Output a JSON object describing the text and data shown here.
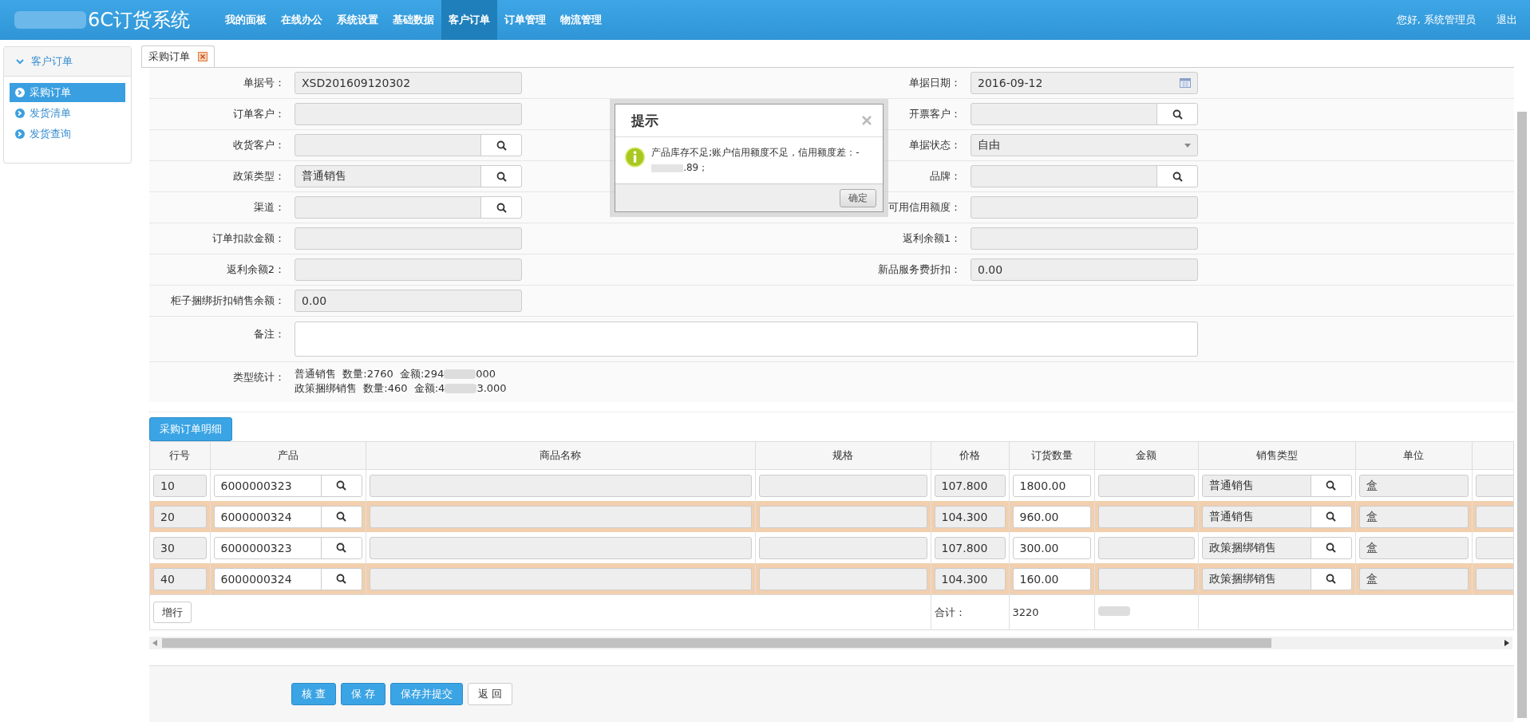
{
  "header": {
    "title": "6C订货系统",
    "nav": [
      {
        "label": "我的面板",
        "selected": false
      },
      {
        "label": "在线办公",
        "selected": false
      },
      {
        "label": "系统设置",
        "selected": false
      },
      {
        "label": "基础数据",
        "selected": false
      },
      {
        "label": "客户订单",
        "selected": true
      },
      {
        "label": "订单管理",
        "selected": false
      },
      {
        "label": "物流管理",
        "selected": false
      }
    ],
    "user": "您好, 系统管理员",
    "logout": "退出"
  },
  "sidebar": {
    "title": "客户订单",
    "items": [
      {
        "label": "采购订单",
        "selected": true
      },
      {
        "label": "发货清单",
        "selected": false
      },
      {
        "label": "发货查询",
        "selected": false
      }
    ]
  },
  "tabs": [
    {
      "label": "采购订单",
      "selected": true
    }
  ],
  "form": {
    "rows": [
      {
        "left": {
          "label": "单据号：",
          "kind": "text",
          "value": "XSD201609120302"
        },
        "right": {
          "label": "单据日期：",
          "kind": "date",
          "value": "2016-09-12"
        }
      },
      {
        "left": {
          "label": "订单客户：",
          "kind": "text"
        },
        "right": {
          "label": "开票客户：",
          "kind": "lookup"
        }
      },
      {
        "left": {
          "label": "收货客户：",
          "kind": "lookup"
        },
        "right": {
          "label": "单据状态：",
          "kind": "select",
          "value": "自由"
        }
      },
      {
        "left": {
          "label": "政策类型：",
          "kind": "lookup",
          "value": "普通销售"
        },
        "right": {
          "label": "品牌：",
          "kind": "lookup"
        }
      },
      {
        "left": {
          "label": "渠道：",
          "kind": "lookup"
        },
        "right": {
          "label": "可用信用额度：",
          "kind": "text"
        }
      },
      {
        "left": {
          "label": "订单扣款金额：",
          "kind": "text"
        },
        "right": {
          "label": "返利余额1：",
          "kind": "text"
        }
      },
      {
        "left": {
          "label": "返利余额2：",
          "kind": "text"
        },
        "right": {
          "label": "新品服务费折扣：",
          "kind": "text",
          "value": "0.00"
        }
      },
      {
        "left": {
          "label": "柜子捆绑折扣销售余额：",
          "kind": "text",
          "value": "0.00"
        }
      }
    ],
    "remark_label": "备注：",
    "stats_label": "类型统计：",
    "stats": [
      {
        "prefix": "普通销售  数量:2760  金额:294",
        "suffix": "000"
      },
      {
        "prefix": "政策捆绑销售  数量:460  金额:4",
        "suffix": "3.000"
      }
    ]
  },
  "detail": {
    "button": "采购订单明细",
    "columns": [
      "行号",
      "产品",
      "商品名称",
      "规格",
      "价格",
      "订货数量",
      "金额",
      "销售类型",
      "单位"
    ],
    "rows": [
      {
        "line": "10",
        "product": "6000000323",
        "price": "107.800",
        "qty": "1800.00",
        "sale_type": "普通销售",
        "unit": "盒",
        "highlighted": false
      },
      {
        "line": "20",
        "product": "6000000324",
        "price": "104.300",
        "qty": "960.00",
        "sale_type": "普通销售",
        "unit": "盒",
        "highlighted": true
      },
      {
        "line": "30",
        "product": "6000000323",
        "price": "107.800",
        "qty": "300.00",
        "sale_type": "政策捆绑销售",
        "unit": "盒",
        "highlighted": false
      },
      {
        "line": "40",
        "product": "6000000324",
        "price": "104.300",
        "qty": "160.00",
        "sale_type": "政策捆绑销售",
        "unit": "盒",
        "highlighted": true
      }
    ],
    "add_row": "增行",
    "total_label": "合计：",
    "total_qty": "3220"
  },
  "actions": [
    {
      "label": "核 查",
      "kind": "primary"
    },
    {
      "label": "保 存",
      "kind": "primary"
    },
    {
      "label": "保存并提交",
      "kind": "primary"
    },
    {
      "label": "返 回",
      "kind": "default"
    }
  ],
  "dialog": {
    "title": "提示",
    "message_prefix": "产品库存不足;账户信用额度不足，信用额度差：-",
    "message_suffix": ".89；",
    "ok": "确定"
  }
}
